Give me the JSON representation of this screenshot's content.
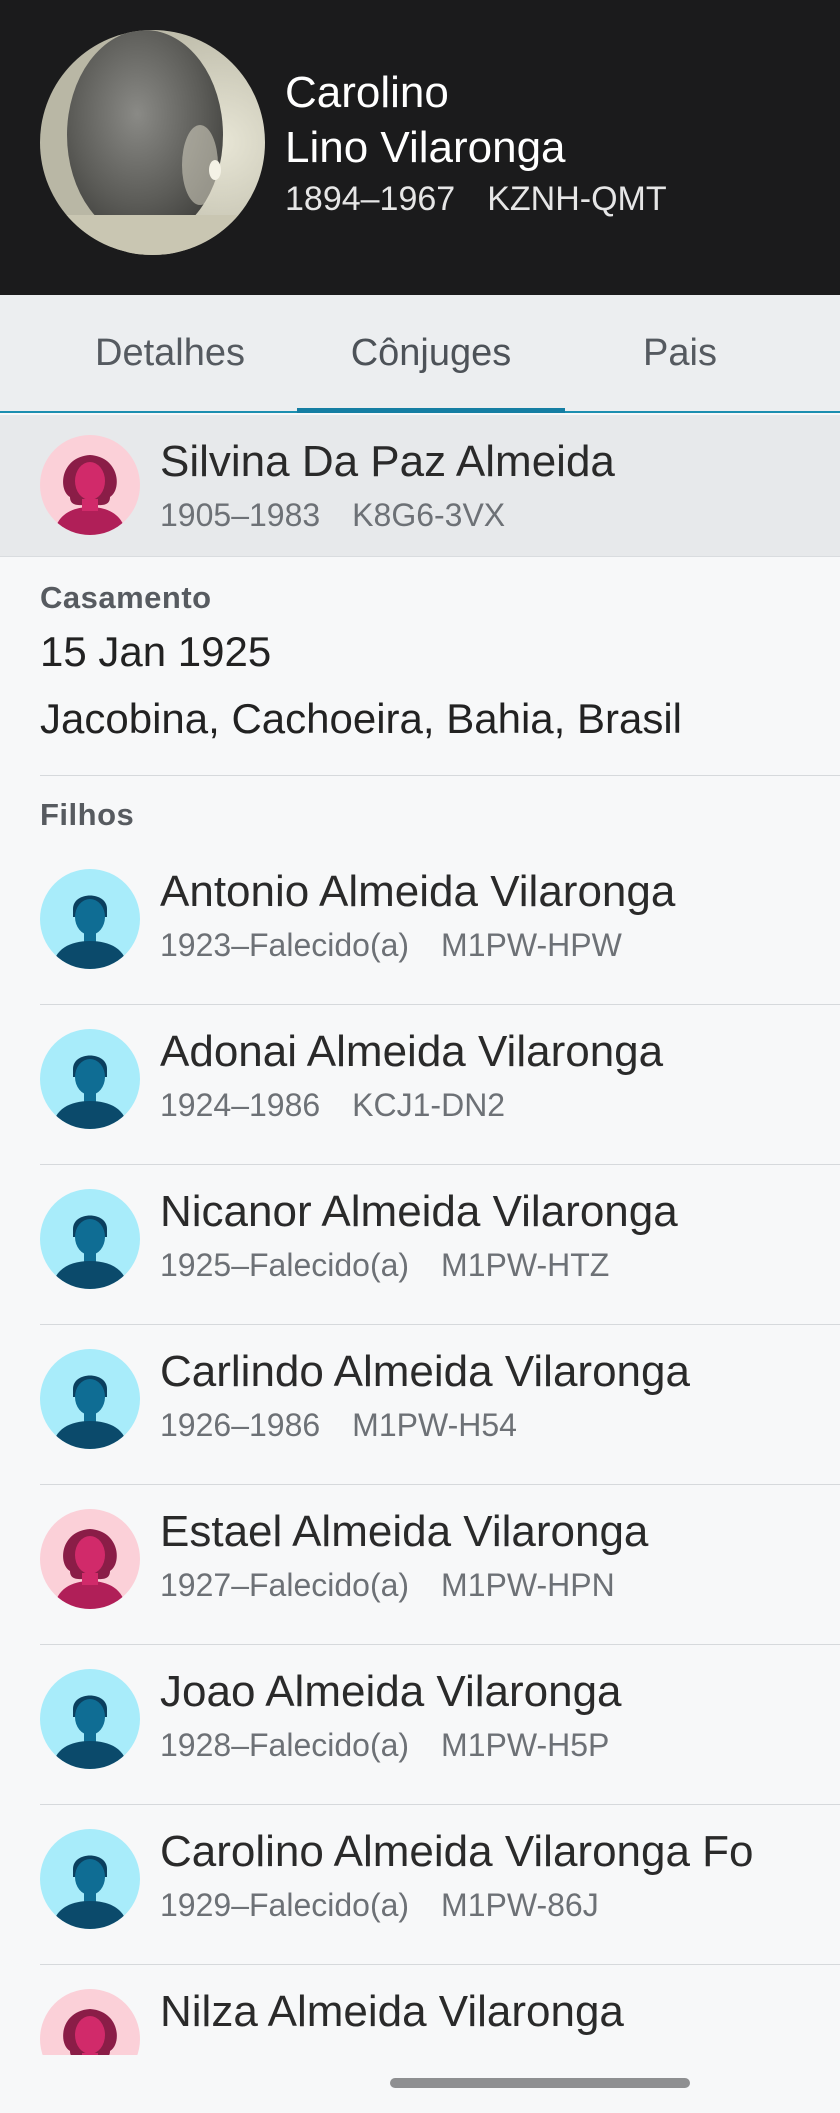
{
  "header": {
    "first_name": "Carolino",
    "last_name": "Lino Vilaronga",
    "lifespan": "1894–1967",
    "pid": "KZNH-QMT"
  },
  "tabs": [
    {
      "label": "Detalhes",
      "active": false
    },
    {
      "label": "Cônjuges",
      "active": true
    },
    {
      "label": "Pais",
      "active": false
    }
  ],
  "spouse": {
    "name": "Silvina Da Paz Almeida",
    "lifespan": "1905–1983",
    "pid": "K8G6-3VX",
    "gender": "female"
  },
  "marriage": {
    "label": "Casamento",
    "date": "15 Jan 1925",
    "place": "Jacobina, Cachoeira, Bahia, Brasil"
  },
  "children_label": "Filhos",
  "children": [
    {
      "name": "Antonio Almeida Vilaronga",
      "lifespan": "1923–Falecido(a)",
      "pid": "M1PW-HPW",
      "gender": "male"
    },
    {
      "name": "Adonai Almeida Vilaronga",
      "lifespan": "1924–1986",
      "pid": "KCJ1-DN2",
      "gender": "male"
    },
    {
      "name": "Nicanor Almeida Vilaronga",
      "lifespan": "1925–Falecido(a)",
      "pid": "M1PW-HTZ",
      "gender": "male"
    },
    {
      "name": "Carlindo Almeida Vilaronga",
      "lifespan": "1926–1986",
      "pid": "M1PW-H54",
      "gender": "male"
    },
    {
      "name": "Estael Almeida Vilaronga",
      "lifespan": "1927–Falecido(a)",
      "pid": "M1PW-HPN",
      "gender": "female"
    },
    {
      "name": "Joao Almeida Vilaronga",
      "lifespan": "1928–Falecido(a)",
      "pid": "M1PW-H5P",
      "gender": "male"
    },
    {
      "name": "Carolino Almeida Vilaronga Fo",
      "lifespan": "1929–Falecido(a)",
      "pid": "M1PW-86J",
      "gender": "male"
    },
    {
      "name": "Nilza Almeida Vilaronga",
      "lifespan": "",
      "pid": "",
      "gender": "female"
    }
  ],
  "icons": {
    "male_avatar": "male-avatar-icon",
    "female_avatar": "female-avatar-icon",
    "portrait": "portrait-photo"
  },
  "colors": {
    "header_bg": "#1b1b1c",
    "tab_accent": "#157ea3",
    "male_avatar_bg": "#a8ecfa",
    "male_avatar_fg": "#0f6d94",
    "female_avatar_bg": "#fbd0d8",
    "female_avatar_fg": "#d12a6a"
  }
}
